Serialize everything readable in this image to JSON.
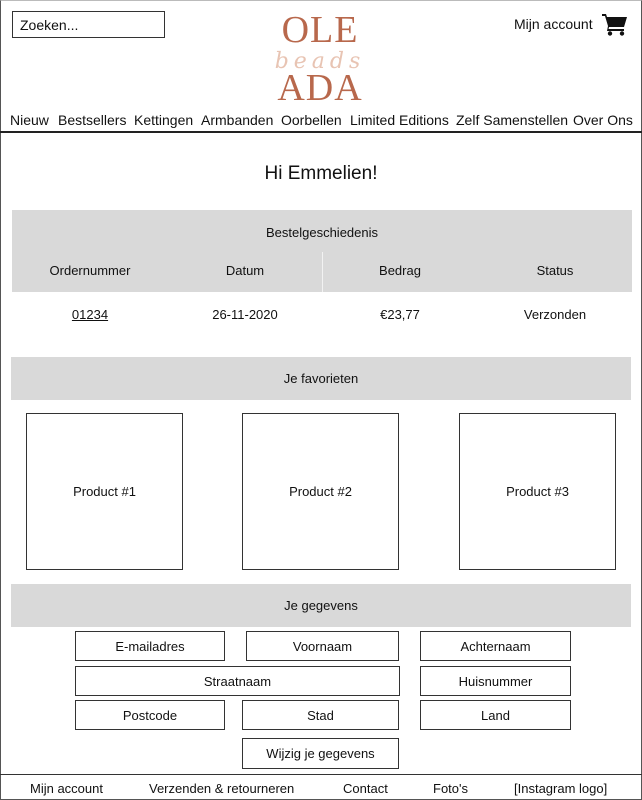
{
  "header": {
    "search_placeholder": "Zoeken...",
    "logo_top": "OLE",
    "logo_script": "beads",
    "logo_bottom": "ADA",
    "account_link": "Mijn account",
    "cart_icon": "shopping-cart-icon"
  },
  "nav": [
    "Nieuw",
    "Bestsellers",
    "Kettingen",
    "Armbanden",
    "Oorbellen",
    "Limited Editions",
    "Zelf Samenstellen",
    "Over Ons"
  ],
  "greeting": "Hi Emmelien!",
  "orders": {
    "title": "Bestelgeschiedenis",
    "columns": [
      "Ordernummer",
      "Datum",
      "Bedrag",
      "Status"
    ],
    "rows": [
      {
        "number": "01234",
        "date": "26-11-2020",
        "amount": "€23,77",
        "status": "Verzonden"
      }
    ]
  },
  "favorites": {
    "title": "Je favorieten",
    "products": [
      "Product #1",
      "Product #2",
      "Product #3"
    ]
  },
  "details": {
    "title": "Je gegevens",
    "fields": {
      "email": "E-mailadres",
      "first_name": "Voornaam",
      "last_name": "Achternaam",
      "street": "Straatnaam",
      "house_number": "Huisnummer",
      "postcode": "Postcode",
      "city": "Stad",
      "country": "Land"
    },
    "edit_button": "Wijzig je gegevens"
  },
  "footer": [
    "Mijn account",
    "Verzenden & retourneren",
    "Contact",
    "Foto's",
    "[Instagram logo]"
  ],
  "colors": {
    "logo": "#b8684c",
    "logo_script": "#e8c4b3",
    "section_bg": "#d9d9d9",
    "border": "#333333"
  }
}
